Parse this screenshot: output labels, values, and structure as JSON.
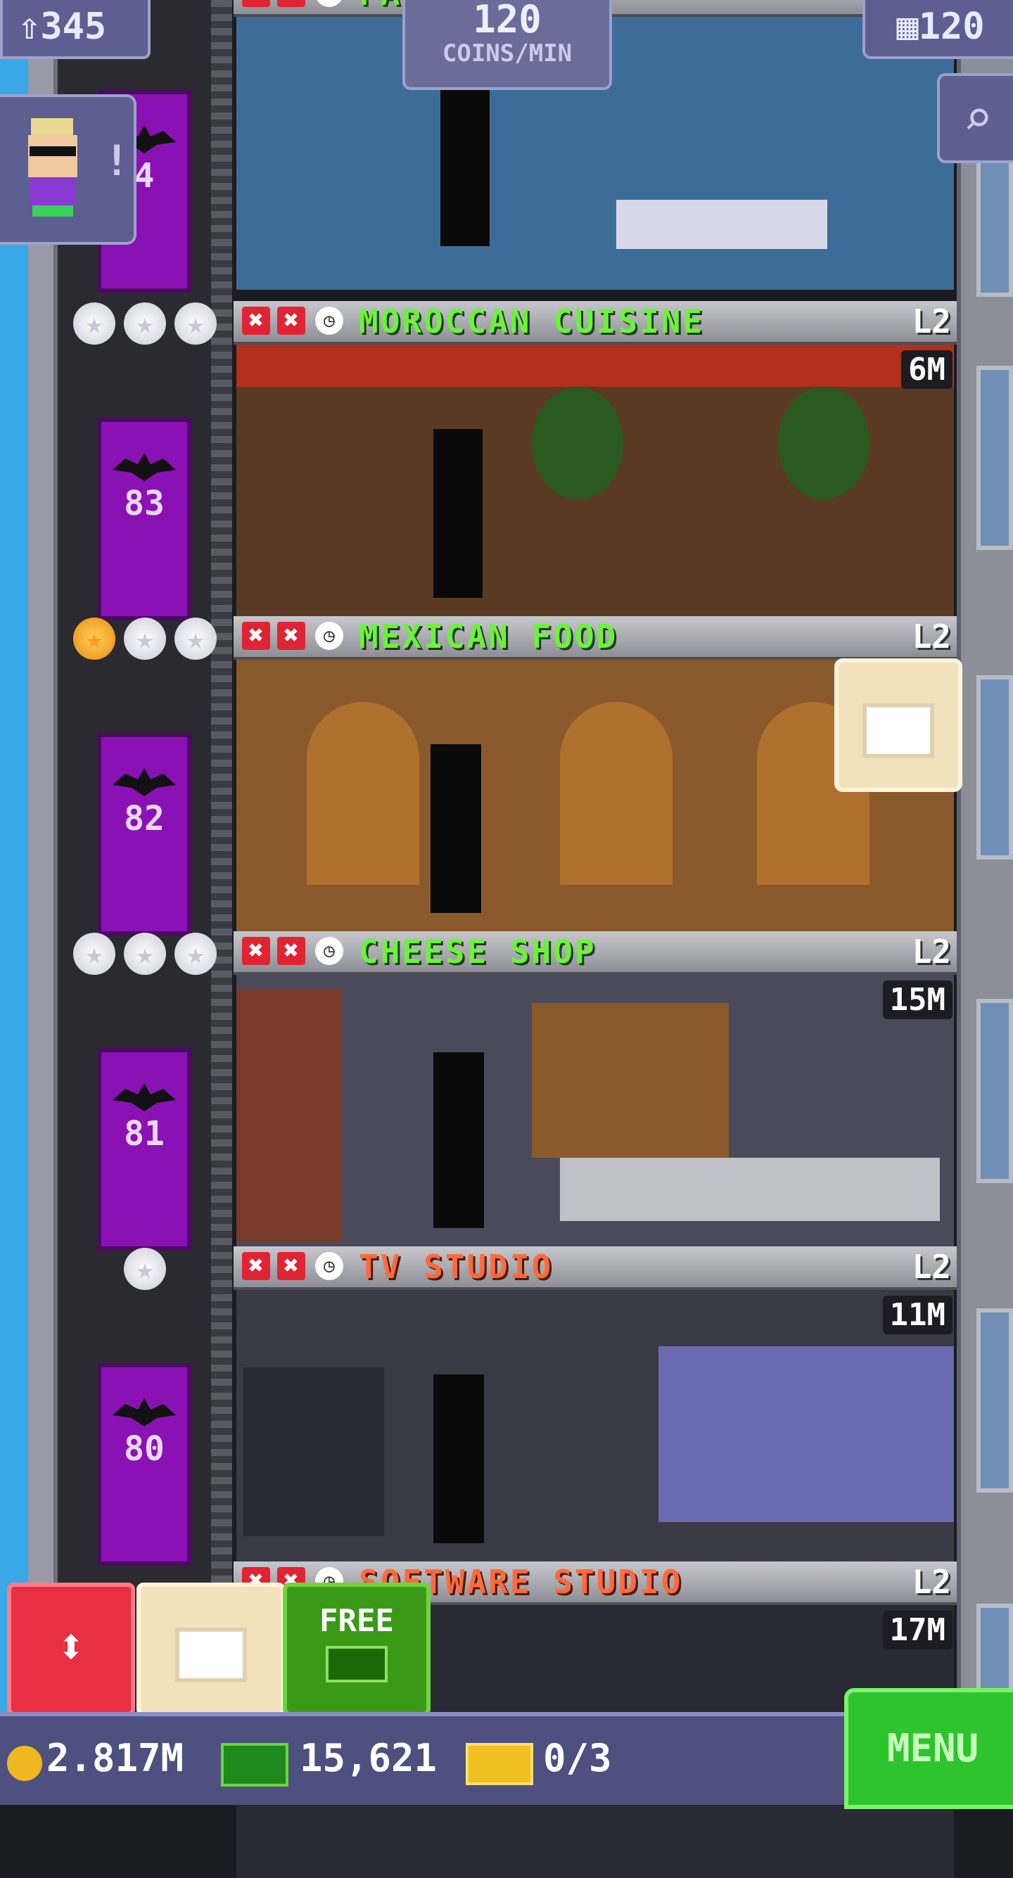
{
  "hud": {
    "population": "345",
    "population_icon": "person-up-icon",
    "coin_rate_value": "120",
    "coin_rate_unit": "COINS/MIN",
    "floor_count": "120",
    "floor_icon": "building-icon",
    "search_icon": "magnifier-icon"
  },
  "top_floor": {
    "title": "FA... INE",
    "room_color": "#3e6c98"
  },
  "floors": [
    {
      "elevator_floor": "4",
      "stars": [
        false,
        false,
        false
      ]
    },
    {
      "name": "MOROCCAN CUISINE",
      "level": "L2",
      "stock": "6M",
      "elevator_floor": "83",
      "stars": [
        false,
        false,
        false
      ],
      "title_color": "green",
      "room_color": "#5a3a22"
    },
    {
      "name": "MEXICAN FOOD",
      "level": "L2",
      "stock": "",
      "elevator_floor": "82",
      "stars": [
        true,
        false,
        false
      ],
      "title_color": "green",
      "room_color": "#8a5a2c"
    },
    {
      "name": "CHEESE SHOP",
      "level": "L2",
      "stock": "15M",
      "elevator_floor": "81",
      "stars": [
        false,
        false,
        false
      ],
      "title_color": "green",
      "room_color": "#4a4a5a"
    },
    {
      "name": "TV STUDIO",
      "level": "L2",
      "stock": "11M",
      "elevator_floor": "80",
      "stars": [
        false
      ],
      "title_color": "orange",
      "room_color": "#3a3a44"
    },
    {
      "name": "SOFTWARE STUDIO",
      "level": "L2",
      "stock": "17M",
      "stars": [
        false,
        false
      ],
      "title_color": "orange",
      "room_color": "#2a2a34"
    }
  ],
  "buttons": {
    "free_label": "FREE",
    "menu_label": "MENU",
    "elevator_icon": "up-down-arrows-icon",
    "build_icon": "crate-icon"
  },
  "status": {
    "coins": "2.817M",
    "bux": "15,621",
    "tickets": "0/3"
  }
}
